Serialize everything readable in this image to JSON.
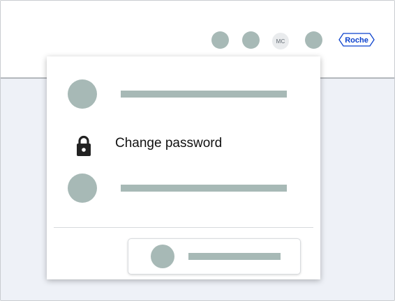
{
  "header": {
    "avatar_initials": "MC",
    "logo_text": "Roche",
    "icons": [
      "header-icon-1",
      "header-icon-2",
      "header-icon-3"
    ]
  },
  "menu": {
    "items": [
      {
        "kind": "placeholder"
      },
      {
        "kind": "action",
        "icon": "lock-icon",
        "label": "Change password"
      },
      {
        "kind": "placeholder"
      }
    ],
    "footer": {
      "kind": "placeholder-button"
    }
  },
  "colors": {
    "placeholder": "#a7b9b6",
    "background": "#eef1f7",
    "logo": "#0b41cd"
  }
}
